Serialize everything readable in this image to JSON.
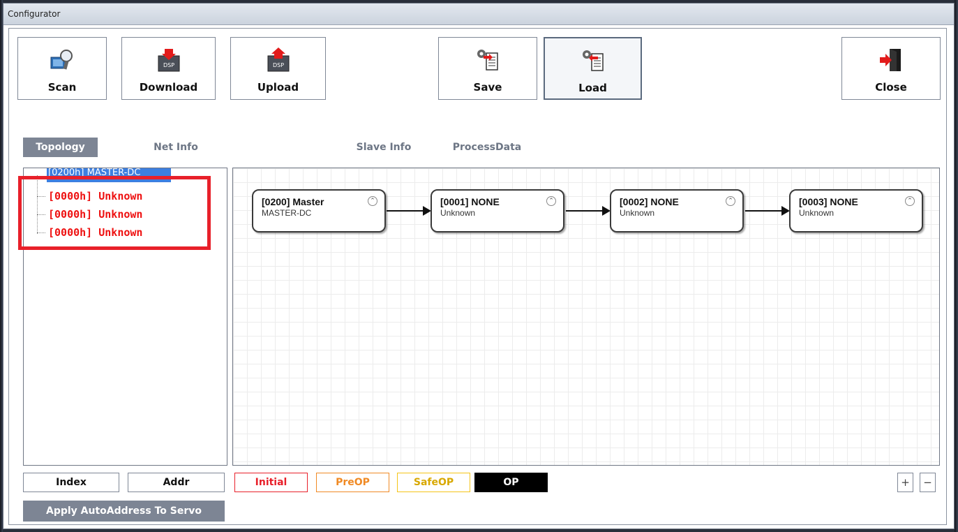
{
  "window": {
    "title": "Configurator"
  },
  "toolbar": {
    "scan": "Scan",
    "download": "Download",
    "upload": "Upload",
    "save": "Save",
    "load": "Load",
    "close": "Close",
    "dsp": "DSP"
  },
  "tabs": {
    "topology": "Topology",
    "net_info": "Net Info",
    "slave_info": "Slave Info",
    "process_data": "ProcessData"
  },
  "tree": {
    "root": "[0200h] MASTER-DC",
    "items": [
      "[0000h] Unknown",
      "[0000h] Unknown",
      "[0000h] Unknown"
    ]
  },
  "nodes": [
    {
      "title": "[0200] Master",
      "sub": "MASTER-DC"
    },
    {
      "title": "[0001] NONE",
      "sub": "Unknown"
    },
    {
      "title": "[0002] NONE",
      "sub": "Unknown"
    },
    {
      "title": "[0003] NONE",
      "sub": "Unknown"
    }
  ],
  "collapse_glyph": "⌃",
  "bottom": {
    "index": "Index",
    "addr": "Addr",
    "apply": "Apply AutoAddress To Servo",
    "zoom_in": "+",
    "zoom_out": "−"
  },
  "states": [
    {
      "label": "Initial",
      "border": "#e8202a",
      "color": "#e8202a"
    },
    {
      "label": "PreOP",
      "border": "#f08a24",
      "color": "#f08a24"
    },
    {
      "label": "SafeOP",
      "border": "#f5c518",
      "color": "#d8a800"
    },
    {
      "label": "OP",
      "bg": "#000000",
      "color": "#ffffff"
    }
  ],
  "colors": {
    "highlight": "#e8202a",
    "tree_selected": "#3d7fe0",
    "tab_active": "#7d8594"
  }
}
